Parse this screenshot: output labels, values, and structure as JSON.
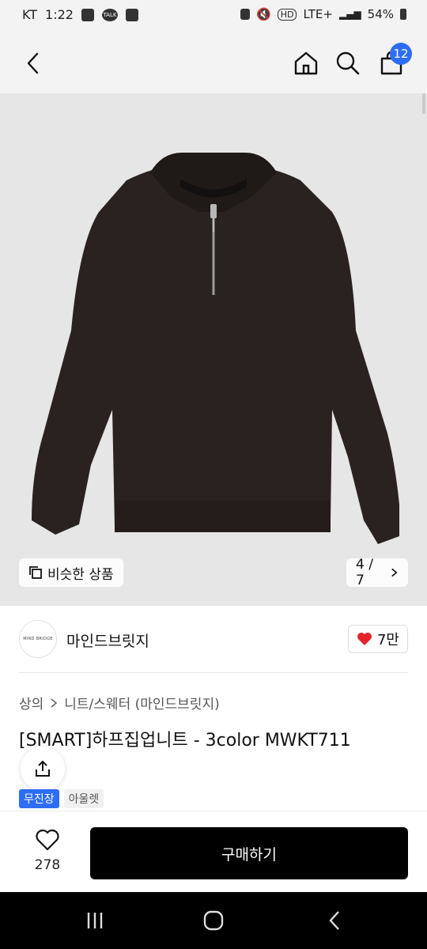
{
  "status_bar": {
    "carrier": "KT",
    "time": "1:22",
    "network": "LTE+",
    "battery": "54%"
  },
  "header": {
    "cart_count": "12"
  },
  "gallery": {
    "similar_label": "비슷한 상품",
    "page_indicator": "4 / 7"
  },
  "brand": {
    "logo_text": "MIND BRIDGE",
    "name": "마인드브릿지",
    "like_count": "7만"
  },
  "breadcrumb": {
    "level1": "상의",
    "level2": "니트/스웨터 (마인드브릿지)"
  },
  "product": {
    "title": "[SMART]하프집업니트 - 3color MWKT711",
    "tags": [
      "무진장",
      "아울렛"
    ]
  },
  "bottom": {
    "wish_count": "278",
    "buy_label": "구매하기"
  },
  "colors": {
    "accent_blue": "#2d6df6",
    "heart_red": "#e8242b",
    "sweater": "#2a2220"
  }
}
